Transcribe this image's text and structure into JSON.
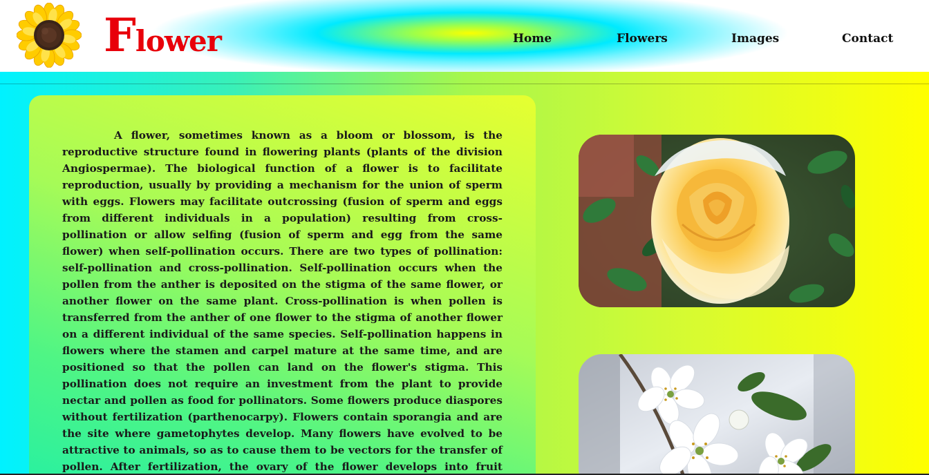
{
  "brand": {
    "initial": "F",
    "rest": "lower",
    "logo_icon": "sunflower-icon",
    "color": "#e8000a"
  },
  "nav": {
    "items": [
      {
        "label": "Home"
      },
      {
        "label": "Flowers"
      },
      {
        "label": "Images"
      },
      {
        "label": "Contact"
      }
    ]
  },
  "article": {
    "text": "A flower, sometimes known as a bloom or blossom, is the reproductive structure found in flowering plants (plants of the division Angiospermae). The biological function of a flower is to facilitate reproduction, usually by providing a mechanism for the union of sperm with eggs. Flowers may facilitate outcrossing (fusion of sperm and eggs from different individuals in a population) resulting from cross-pollination or allow selfing (fusion of sperm and egg from the same flower) when self-pollination occurs. There are two types of pollination: self-pollination and cross-pollination. Self-pollination occurs when the pollen from the anther is deposited on the stigma of the same flower, or another flower on the same plant. Cross-pollination is when pollen is transferred from the anther of one flower to the stigma of another flower on a different individual of the same species. Self-pollination happens in flowers where the stamen and carpel mature at the same time, and are positioned so that the pollen can land on the flower's stigma. This pollination does not require an investment from the plant to provide nectar and pollen as food for pollinators. Some flowers produce diaspores without fertilization (parthenocarpy). Flowers contain sporangia and are the site where gametophytes develop. Many flowers have evolved to be attractive to animals, so as to cause them to be vectors for the transfer of pollen. After fertilization, the ovary of the flower develops into fruit containing seeds. In addition to facilitating the reproduction of"
  },
  "images": [
    {
      "subject": "yellow-rose-photo"
    },
    {
      "subject": "white-cherry-blossom-photo"
    }
  ],
  "colors": {
    "background_left": "#00f2ff",
    "background_right": "#ffff00",
    "text": "#1a1a1a"
  }
}
